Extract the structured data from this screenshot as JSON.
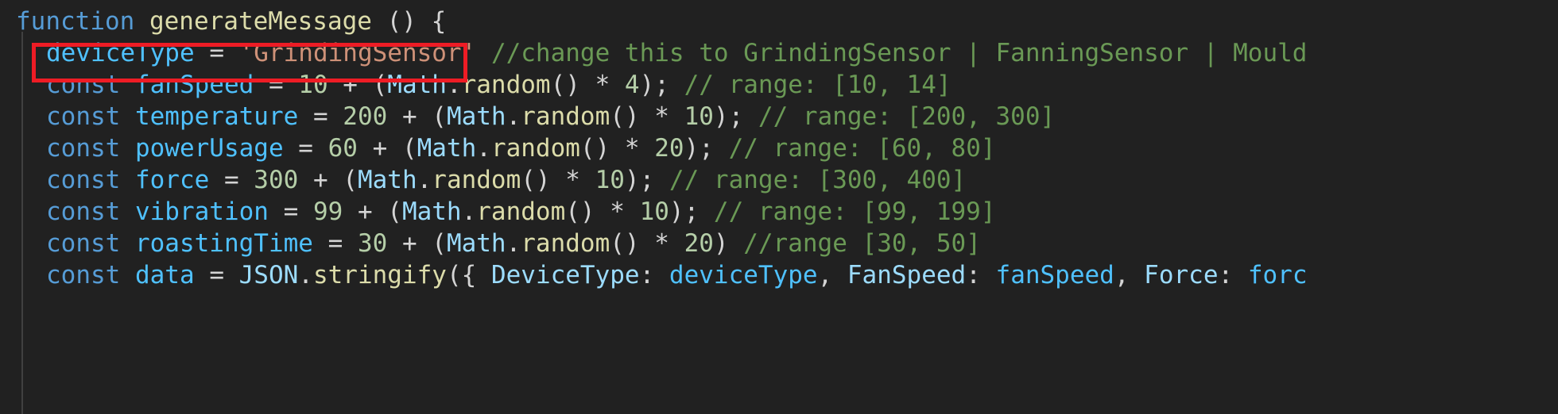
{
  "editor": {
    "background_color": "#212121",
    "theme": "dark-plus",
    "annotation": {
      "shape": "rectangle",
      "color": "#ee1c25",
      "target_text": "deviceType = 'GrindingSensor'"
    }
  },
  "code": {
    "language": "javascript",
    "lines": [
      {
        "id": "line-1",
        "indented": false,
        "text": "function generateMessage () {",
        "tokens": [
          {
            "t": "function ",
            "c": "tk-keyword"
          },
          {
            "t": "generateMessage ",
            "c": "tk-function"
          },
          {
            "t": "() {",
            "c": "tk-plain"
          }
        ]
      },
      {
        "id": "line-2",
        "indented": true,
        "text": "deviceType = 'GrindingSensor' //change this to GrindingSensor | FanningSensor | Mould",
        "tokens": [
          {
            "t": "deviceType ",
            "c": "tk-ident"
          },
          {
            "t": "= ",
            "c": "tk-plain"
          },
          {
            "t": "'GrindingSensor'",
            "c": "tk-string"
          },
          {
            "t": " ",
            "c": "tk-plain"
          },
          {
            "t": "//change this to GrindingSensor | FanningSensor | Mould",
            "c": "tk-comment"
          }
        ]
      },
      {
        "id": "line-3",
        "indented": true,
        "text": "const fanSpeed = 10 + (Math.random() * 4); // range: [10, 14]",
        "tokens": [
          {
            "t": "const ",
            "c": "tk-keyword"
          },
          {
            "t": "fanSpeed ",
            "c": "tk-ident"
          },
          {
            "t": "= ",
            "c": "tk-plain"
          },
          {
            "t": "10",
            "c": "tk-number"
          },
          {
            "t": " + (",
            "c": "tk-plain"
          },
          {
            "t": "Math",
            "c": "tk-variable"
          },
          {
            "t": ".",
            "c": "tk-plain"
          },
          {
            "t": "random",
            "c": "tk-method"
          },
          {
            "t": "() * ",
            "c": "tk-plain"
          },
          {
            "t": "4",
            "c": "tk-number"
          },
          {
            "t": "); ",
            "c": "tk-plain"
          },
          {
            "t": "// range: [10, 14]",
            "c": "tk-comment"
          }
        ]
      },
      {
        "id": "line-4",
        "indented": true,
        "text": "const temperature = 200 + (Math.random() * 10); // range: [200, 300]",
        "tokens": [
          {
            "t": "const ",
            "c": "tk-keyword"
          },
          {
            "t": "temperature ",
            "c": "tk-ident"
          },
          {
            "t": "= ",
            "c": "tk-plain"
          },
          {
            "t": "200",
            "c": "tk-number"
          },
          {
            "t": " + (",
            "c": "tk-plain"
          },
          {
            "t": "Math",
            "c": "tk-variable"
          },
          {
            "t": ".",
            "c": "tk-plain"
          },
          {
            "t": "random",
            "c": "tk-method"
          },
          {
            "t": "() * ",
            "c": "tk-plain"
          },
          {
            "t": "10",
            "c": "tk-number"
          },
          {
            "t": "); ",
            "c": "tk-plain"
          },
          {
            "t": "// range: [200, 300]",
            "c": "tk-comment"
          }
        ]
      },
      {
        "id": "line-5",
        "indented": true,
        "text": "const powerUsage = 60 + (Math.random() * 20); // range: [60, 80]",
        "tokens": [
          {
            "t": "const ",
            "c": "tk-keyword"
          },
          {
            "t": "powerUsage ",
            "c": "tk-ident"
          },
          {
            "t": "= ",
            "c": "tk-plain"
          },
          {
            "t": "60",
            "c": "tk-number"
          },
          {
            "t": " + (",
            "c": "tk-plain"
          },
          {
            "t": "Math",
            "c": "tk-variable"
          },
          {
            "t": ".",
            "c": "tk-plain"
          },
          {
            "t": "random",
            "c": "tk-method"
          },
          {
            "t": "() * ",
            "c": "tk-plain"
          },
          {
            "t": "20",
            "c": "tk-number"
          },
          {
            "t": "); ",
            "c": "tk-plain"
          },
          {
            "t": "// range: [60, 80]",
            "c": "tk-comment"
          }
        ]
      },
      {
        "id": "line-6",
        "indented": true,
        "text": "const force = 300 + (Math.random() * 10); // range: [300, 400]",
        "tokens": [
          {
            "t": "const ",
            "c": "tk-keyword"
          },
          {
            "t": "force ",
            "c": "tk-ident"
          },
          {
            "t": "= ",
            "c": "tk-plain"
          },
          {
            "t": "300",
            "c": "tk-number"
          },
          {
            "t": " + (",
            "c": "tk-plain"
          },
          {
            "t": "Math",
            "c": "tk-variable"
          },
          {
            "t": ".",
            "c": "tk-plain"
          },
          {
            "t": "random",
            "c": "tk-method"
          },
          {
            "t": "() * ",
            "c": "tk-plain"
          },
          {
            "t": "10",
            "c": "tk-number"
          },
          {
            "t": "); ",
            "c": "tk-plain"
          },
          {
            "t": "// range: [300, 400]",
            "c": "tk-comment"
          }
        ]
      },
      {
        "id": "line-7",
        "indented": true,
        "text": "const vibration = 99 + (Math.random() * 10); // range: [99, 199]",
        "tokens": [
          {
            "t": "const ",
            "c": "tk-keyword"
          },
          {
            "t": "vibration ",
            "c": "tk-ident"
          },
          {
            "t": "= ",
            "c": "tk-plain"
          },
          {
            "t": "99",
            "c": "tk-number"
          },
          {
            "t": " + (",
            "c": "tk-plain"
          },
          {
            "t": "Math",
            "c": "tk-variable"
          },
          {
            "t": ".",
            "c": "tk-plain"
          },
          {
            "t": "random",
            "c": "tk-method"
          },
          {
            "t": "() * ",
            "c": "tk-plain"
          },
          {
            "t": "10",
            "c": "tk-number"
          },
          {
            "t": "); ",
            "c": "tk-plain"
          },
          {
            "t": "// range: [99, 199]",
            "c": "tk-comment"
          }
        ]
      },
      {
        "id": "line-8",
        "indented": true,
        "text": "const roastingTime = 30 + (Math.random() * 20) //range [30, 50]",
        "tokens": [
          {
            "t": "const ",
            "c": "tk-keyword"
          },
          {
            "t": "roastingTime ",
            "c": "tk-ident"
          },
          {
            "t": "= ",
            "c": "tk-plain"
          },
          {
            "t": "30",
            "c": "tk-number"
          },
          {
            "t": " + (",
            "c": "tk-plain"
          },
          {
            "t": "Math",
            "c": "tk-variable"
          },
          {
            "t": ".",
            "c": "tk-plain"
          },
          {
            "t": "random",
            "c": "tk-method"
          },
          {
            "t": "() * ",
            "c": "tk-plain"
          },
          {
            "t": "20",
            "c": "tk-number"
          },
          {
            "t": ") ",
            "c": "tk-plain"
          },
          {
            "t": "//range [30, 50]",
            "c": "tk-comment"
          }
        ]
      },
      {
        "id": "line-9",
        "indented": true,
        "text": "const data = JSON.stringify({ DeviceType: deviceType, FanSpeed: fanSpeed, Force: forc",
        "tokens": [
          {
            "t": "const ",
            "c": "tk-keyword"
          },
          {
            "t": "data ",
            "c": "tk-ident"
          },
          {
            "t": "= ",
            "c": "tk-plain"
          },
          {
            "t": "JSON",
            "c": "tk-variable"
          },
          {
            "t": ".",
            "c": "tk-plain"
          },
          {
            "t": "stringify",
            "c": "tk-method"
          },
          {
            "t": "({ ",
            "c": "tk-plain"
          },
          {
            "t": "DeviceType",
            "c": "tk-prop"
          },
          {
            "t": ": ",
            "c": "tk-plain"
          },
          {
            "t": "deviceType",
            "c": "tk-ident"
          },
          {
            "t": ", ",
            "c": "tk-plain"
          },
          {
            "t": "FanSpeed",
            "c": "tk-prop"
          },
          {
            "t": ": ",
            "c": "tk-plain"
          },
          {
            "t": "fanSpeed",
            "c": "tk-ident"
          },
          {
            "t": ", ",
            "c": "tk-plain"
          },
          {
            "t": "Force",
            "c": "tk-prop"
          },
          {
            "t": ": ",
            "c": "tk-plain"
          },
          {
            "t": "forc",
            "c": "tk-ident"
          }
        ]
      }
    ]
  }
}
